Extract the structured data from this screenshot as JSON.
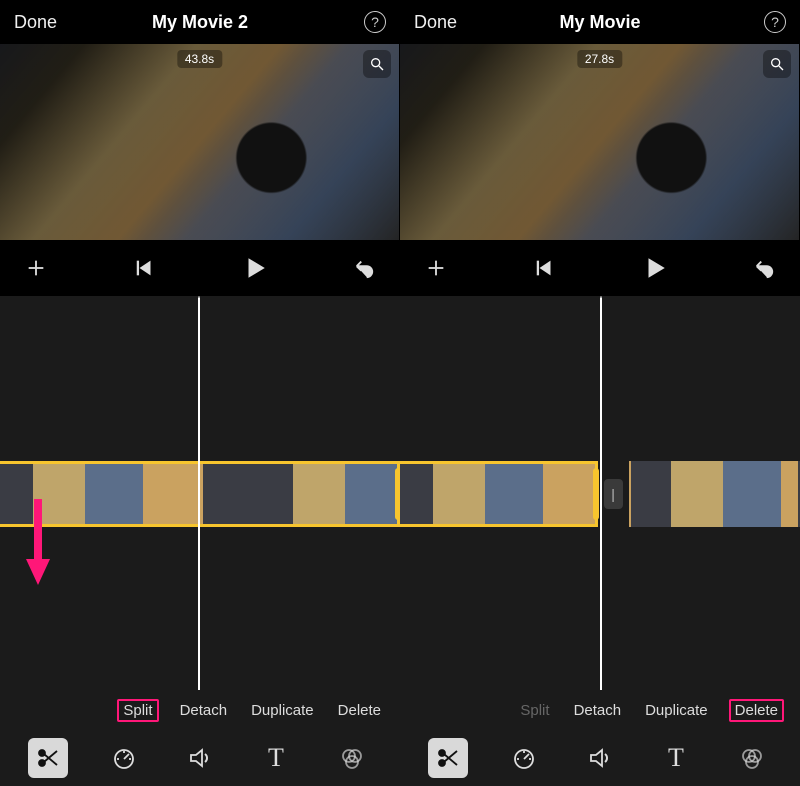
{
  "left": {
    "header": {
      "done": "Done",
      "title": "My Movie 2"
    },
    "preview": {
      "time": "43.8s"
    },
    "actions": {
      "split": "Split",
      "detach": "Detach",
      "duplicate": "Duplicate",
      "delete": "Delete",
      "split_disabled": false,
      "highlight": "split"
    },
    "toolbar_selected": "scissors"
  },
  "right": {
    "header": {
      "done": "Done",
      "title": "My Movie"
    },
    "preview": {
      "time": "27.8s"
    },
    "actions": {
      "split": "Split",
      "detach": "Detach",
      "duplicate": "Duplicate",
      "delete": "Delete",
      "split_disabled": true,
      "highlight": "delete"
    },
    "toolbar_selected": "scissors"
  },
  "icons": {
    "help": "?",
    "gap_pill": "|",
    "text_tool": "T"
  }
}
